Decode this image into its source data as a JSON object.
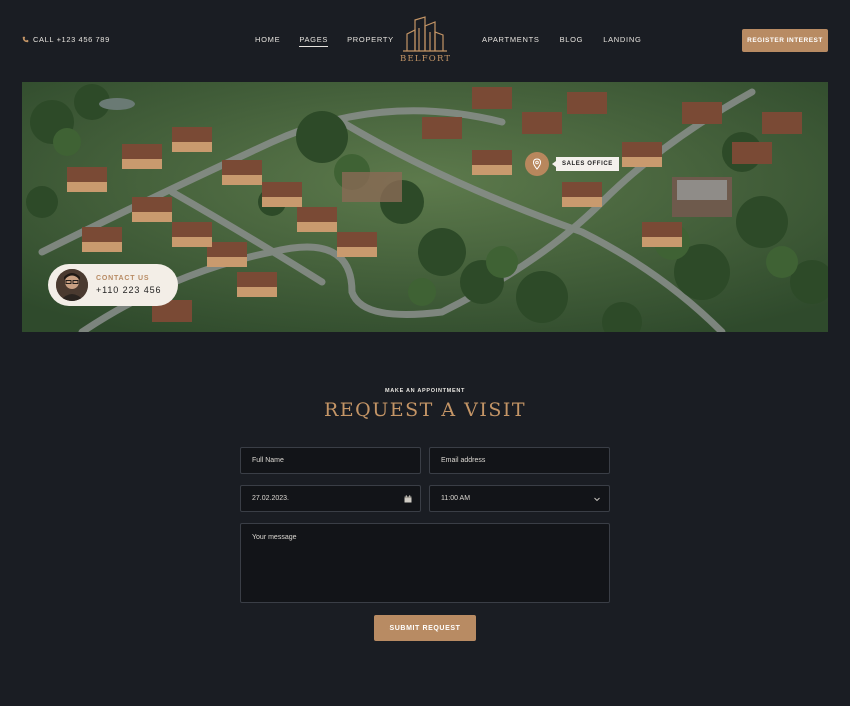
{
  "header": {
    "phone": "CALL +123 456 789",
    "nav_left": [
      "HOME",
      "PAGES",
      "PROPERTY"
    ],
    "nav_right": [
      "APARTMENTS",
      "BLOG",
      "LANDING"
    ],
    "active": "PAGES",
    "brand": "BELFORT",
    "cta": "REGISTER INTEREST"
  },
  "hero": {
    "pin_label": "SALES OFFICE",
    "contact_label": "CONTACT US",
    "contact_phone": "+110 223 456"
  },
  "form": {
    "eyebrow": "MAKE AN APPOINTMENT",
    "title": "REQUEST A VISIT",
    "name_placeholder": "Full Name",
    "email_placeholder": "Email address",
    "date_value": "27.02.2023.",
    "time_value": "11:00 AM",
    "message_placeholder": "Your message",
    "submit": "SUBMIT REQUEST"
  },
  "colors": {
    "accent": "#b88b63",
    "background": "#1a1d23"
  }
}
